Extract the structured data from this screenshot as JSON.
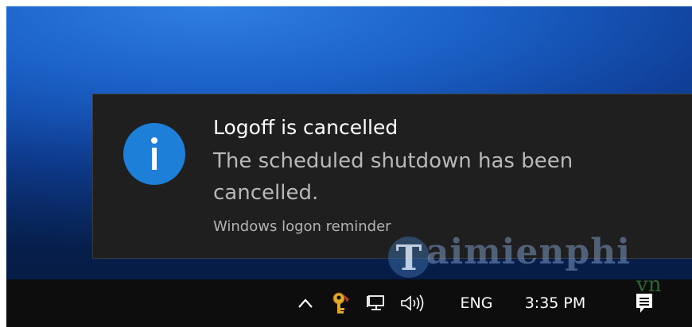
{
  "toast": {
    "title": "Logoff is cancelled",
    "body": "The scheduled shutdown has been cancelled.",
    "source": "Windows logon reminder",
    "icon": "info-icon",
    "icon_color": "#1e7fd8",
    "background": "#1f1f1f"
  },
  "taskbar": {
    "tray_icons": [
      "show-hidden-icons-chevron",
      "key-icon",
      "network-icon",
      "volume-icon"
    ],
    "language": "ENG",
    "clock": "3:35 PM",
    "action_center_icon": "action-center-icon"
  },
  "watermark": {
    "text": "aimienphi",
    "suffix": "vn",
    "mark_letter": "T"
  },
  "colors": {
    "desktop_accent": "#1a5fc4",
    "taskbar": "#0d0d0d",
    "text_primary": "#ffffff",
    "text_secondary": "#b8b8b8"
  }
}
